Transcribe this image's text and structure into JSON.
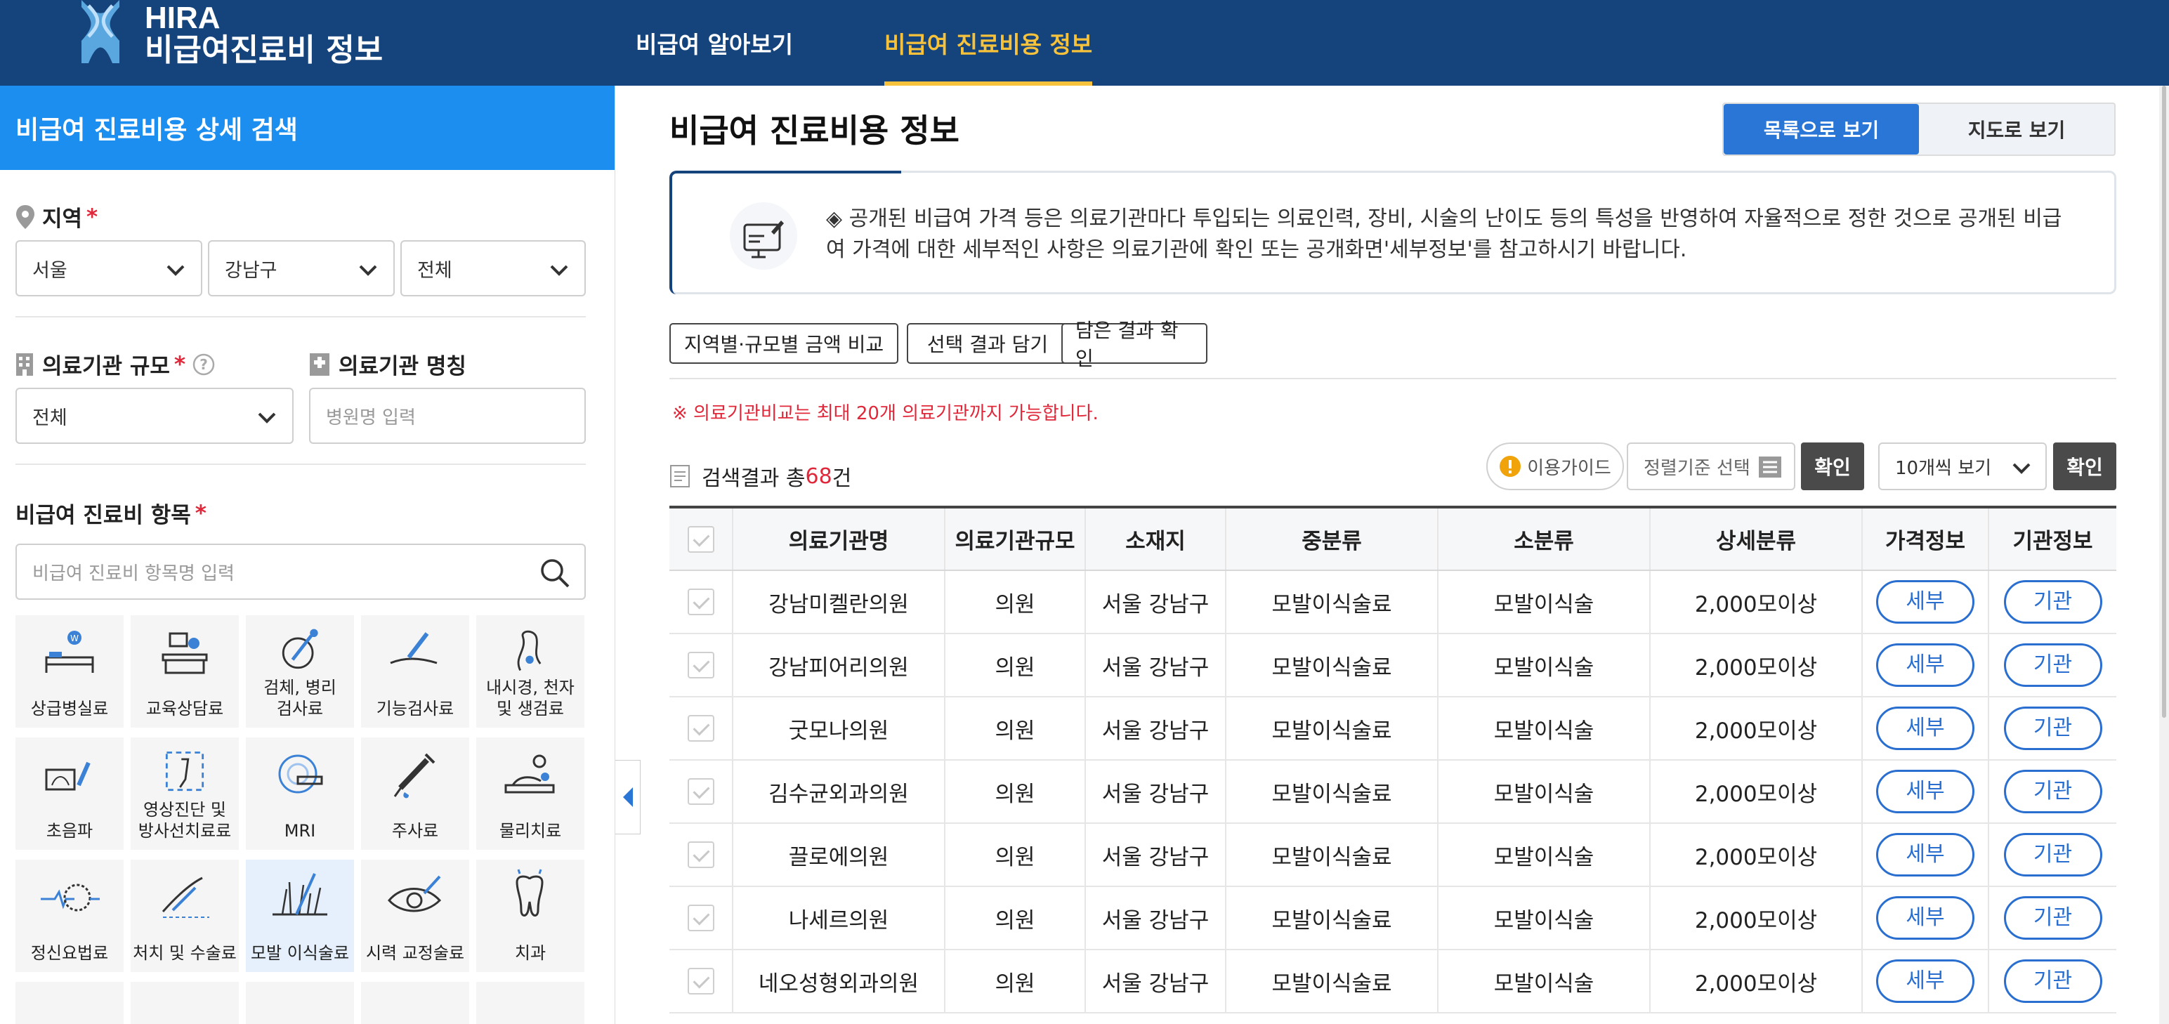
{
  "header": {
    "logo_line1": "HIRA",
    "logo_line2": "비급여진료비 정보",
    "nav": [
      {
        "label": "비급여 알아보기",
        "active": false
      },
      {
        "label": "비급여 진료비용 정보",
        "active": true
      }
    ]
  },
  "sidebar": {
    "title": "비급여 진료비용 상세 검색",
    "region_label": "지역",
    "region": {
      "city": "서울",
      "district": "강남구",
      "dong": "전체"
    },
    "scale_label": "의료기관 규모",
    "scale_value": "전체",
    "name_label": "의료기관 명칭",
    "name_placeholder": "병원명 입력",
    "item_label": "비급여 진료비 항목",
    "item_placeholder": "비급여 진료비 항목명 입력",
    "categories": [
      {
        "label": "상급병실료",
        "icon": "bed-icon"
      },
      {
        "label": "교육상담료",
        "icon": "counseling-icon"
      },
      {
        "label": "검체, 병리\n검사료",
        "icon": "specimen-icon"
      },
      {
        "label": "기능검사료",
        "icon": "function-test-icon"
      },
      {
        "label": "내시경, 천자\n및 생검료",
        "icon": "endoscope-icon"
      },
      {
        "label": "초음파",
        "icon": "ultrasound-icon"
      },
      {
        "label": "영상진단 및\n방사선치료료",
        "icon": "xray-icon"
      },
      {
        "label": "MRI",
        "icon": "mri-icon"
      },
      {
        "label": "주사료",
        "icon": "syringe-icon"
      },
      {
        "label": "물리치료",
        "icon": "physio-icon"
      },
      {
        "label": "정신요법료",
        "icon": "brain-icon"
      },
      {
        "label": "처치 및 수술료",
        "icon": "surgery-icon"
      },
      {
        "label": "모발 이식술료",
        "icon": "hair-icon",
        "selected": true
      },
      {
        "label": "시력 교정술료",
        "icon": "eye-icon"
      },
      {
        "label": "치과",
        "icon": "tooth-icon"
      }
    ]
  },
  "main": {
    "title": "비급여 진료비용 정보",
    "view_list": "목록으로 보기",
    "view_map": "지도로 보기",
    "notice": "◈ 공개된 비급여 가격 등은 의료기관마다 투입되는 의료인력, 장비, 시술의 난이도 등의 특성을 반영하여 자율적으로 정한 것으로 공개된 비급여 가격에 대한 세부적인 사항은 의료기관에 확인 또는 공개화면'세부정보'를 참고하시기 바랍니다.",
    "actions": [
      "지역별·규모별 금액 비교",
      "선택 결과 담기",
      "담은 결과 확인"
    ],
    "warning": "※ 의료기관비교는 최대 20개 의료기관까지 가능합니다.",
    "result_prefix": "검색결과 총",
    "result_count": "68",
    "result_suffix": "건",
    "guide": "이용가이드",
    "sort_placeholder": "정렬기준 선택",
    "confirm": "확인",
    "per_page": "10개씩 보기",
    "columns": [
      "의료기관명",
      "의료기관규모",
      "소재지",
      "중분류",
      "소분류",
      "상세분류",
      "가격정보",
      "기관정보"
    ],
    "detail_btn": "세부",
    "inst_btn": "기관",
    "rows": [
      {
        "name": "강남미켈란의원",
        "scale": "의원",
        "loc": "서울 강남구",
        "mid": "모발이식술료",
        "sub": "모발이식술",
        "detail": "2,000모이상"
      },
      {
        "name": "강남피어리의원",
        "scale": "의원",
        "loc": "서울 강남구",
        "mid": "모발이식술료",
        "sub": "모발이식술",
        "detail": "2,000모이상"
      },
      {
        "name": "굿모나의원",
        "scale": "의원",
        "loc": "서울 강남구",
        "mid": "모발이식술료",
        "sub": "모발이식술",
        "detail": "2,000모이상"
      },
      {
        "name": "김수균외과의원",
        "scale": "의원",
        "loc": "서울 강남구",
        "mid": "모발이식술료",
        "sub": "모발이식술",
        "detail": "2,000모이상"
      },
      {
        "name": "끌로에의원",
        "scale": "의원",
        "loc": "서울 강남구",
        "mid": "모발이식술료",
        "sub": "모발이식술",
        "detail": "2,000모이상"
      },
      {
        "name": "나세르의원",
        "scale": "의원",
        "loc": "서울 강남구",
        "mid": "모발이식술료",
        "sub": "모발이식술",
        "detail": "2,000모이상"
      },
      {
        "name": "네오성형외과의원",
        "scale": "의원",
        "loc": "서울 강남구",
        "mid": "모발이식술료",
        "sub": "모발이식술",
        "detail": "2,000모이상"
      }
    ]
  },
  "colors": {
    "header": "#15447c",
    "accent": "#1b8ef0",
    "active_nav": "#f7c23b",
    "primary_btn": "#2a76d6",
    "required": "#e0283a"
  }
}
